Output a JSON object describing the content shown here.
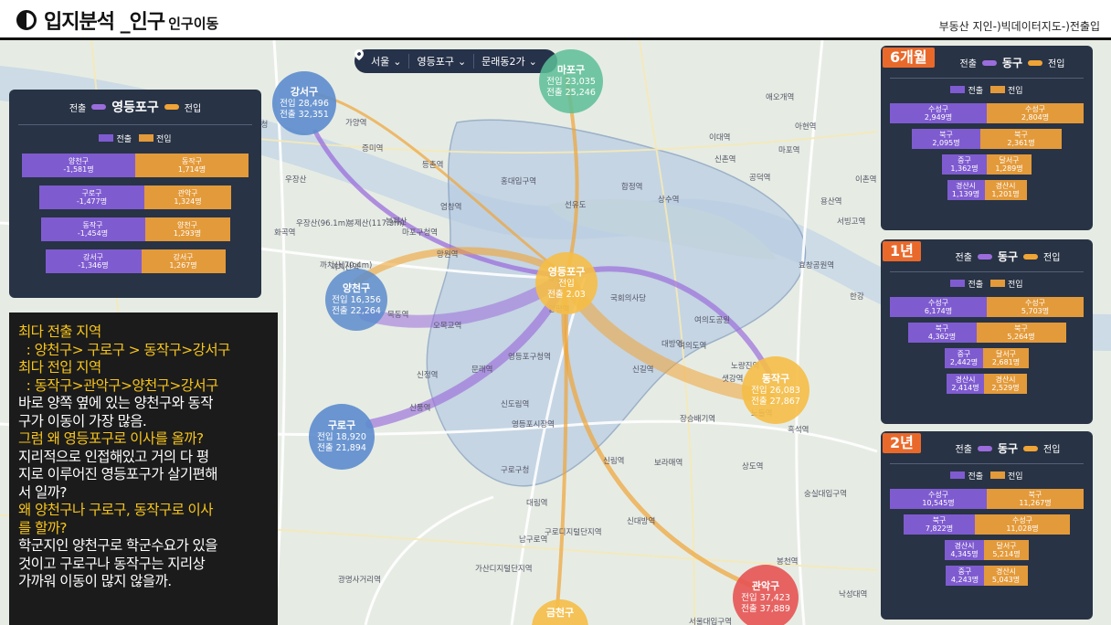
{
  "header": {
    "title_main": "입지분석 _인구",
    "title_sub": "인구이동",
    "breadcrumb": "부동산 지인-)빅데이터지도-)전출입"
  },
  "selector": {
    "city": "서울",
    "district": "영등포구",
    "dong": "문래동2가"
  },
  "colors": {
    "out_flow": "#9b6ddc",
    "in_flow": "#f0a436",
    "panel_bg": "#283345",
    "badge": "#e9692b"
  },
  "bubbles": [
    {
      "id": "gangseo",
      "name": "강서구",
      "out": "전입 28,496",
      "in": "전출 32,351"
    },
    {
      "id": "mapo",
      "name": "마포구",
      "out": "전입 23,035",
      "in": "전출 25,246"
    },
    {
      "id": "yangcheon",
      "name": "양천구",
      "out": "전입 16,356",
      "in": "전출 22,264"
    },
    {
      "id": "yeongdeungpo",
      "name": "영등포구",
      "out": "전입",
      "in": "전출 2.03"
    },
    {
      "id": "dongjak",
      "name": "동작구",
      "out": "전입 26,083",
      "in": "전출 27,867"
    },
    {
      "id": "guro",
      "name": "구로구",
      "out": "전입 18,920",
      "in": "전출 21,894"
    },
    {
      "id": "gwanak",
      "name": "관악구",
      "out": "전입 37,423",
      "in": "전출 37,889"
    },
    {
      "id": "geumcheon",
      "name": "금천구",
      "out": "",
      "in": ""
    }
  ],
  "main_panel": {
    "out_label": "전출",
    "in_label": "전입",
    "district": "영등포구",
    "legend_out": "전출",
    "legend_in": "전입",
    "rows": [
      {
        "out_name": "양천구",
        "out_val": "-1,581명",
        "in_name": "동작구",
        "in_val": "1,714명",
        "out_frac": 1.0,
        "in_frac": 1.0
      },
      {
        "out_name": "구로구",
        "out_val": "-1,477명",
        "in_name": "관악구",
        "in_val": "1,324명",
        "out_frac": 0.93,
        "in_frac": 0.77
      },
      {
        "out_name": "동작구",
        "out_val": "-1,454명",
        "in_name": "양천구",
        "in_val": "1,293명",
        "out_frac": 0.92,
        "in_frac": 0.75
      },
      {
        "out_name": "강서구",
        "out_val": "-1,346명",
        "in_name": "강서구",
        "in_val": "1,267명",
        "out_frac": 0.85,
        "in_frac": 0.74
      }
    ]
  },
  "side_panels": [
    {
      "badge": "6개월",
      "out_label": "전출",
      "district": "동구",
      "in_label": "전입",
      "legend_out": "전출",
      "legend_in": "전입",
      "rows": [
        {
          "out_name": "수성구",
          "out_val": "2,949명",
          "in_name": "수성구",
          "in_val": "2,804명",
          "out_frac": 1.0,
          "in_frac": 1.0
        },
        {
          "out_name": "북구",
          "out_val": "2,095명",
          "in_name": "북구",
          "in_val": "2,361명",
          "out_frac": 0.71,
          "in_frac": 0.84
        },
        {
          "out_name": "중구",
          "out_val": "1,362명",
          "in_name": "달서구",
          "in_val": "1,289명",
          "out_frac": 0.46,
          "in_frac": 0.46
        },
        {
          "out_name": "경산시",
          "out_val": "1,139명",
          "in_name": "경산시",
          "in_val": "1,201명",
          "out_frac": 0.39,
          "in_frac": 0.43
        }
      ]
    },
    {
      "badge": "1년",
      "out_label": "전출",
      "district": "동구",
      "in_label": "전입",
      "legend_out": "전출",
      "legend_in": "전입",
      "rows": [
        {
          "out_name": "수성구",
          "out_val": "6,174명",
          "in_name": "수성구",
          "in_val": "5,703명",
          "out_frac": 1.0,
          "in_frac": 1.0
        },
        {
          "out_name": "북구",
          "out_val": "4,362명",
          "in_name": "북구",
          "in_val": "5,264명",
          "out_frac": 0.71,
          "in_frac": 0.92
        },
        {
          "out_name": "중구",
          "out_val": "2,442명",
          "in_name": "달서구",
          "in_val": "2,681명",
          "out_frac": 0.4,
          "in_frac": 0.47
        },
        {
          "out_name": "경산시",
          "out_val": "2,414명",
          "in_name": "경산시",
          "in_val": "2,529명",
          "out_frac": 0.39,
          "in_frac": 0.44
        }
      ]
    },
    {
      "badge": "2년",
      "out_label": "전출",
      "district": "동구",
      "in_label": "전입",
      "legend_out": "전출",
      "legend_in": "전입",
      "rows": [
        {
          "out_name": "수성구",
          "out_val": "10,545명",
          "in_name": "북구",
          "in_val": "11,267명",
          "out_frac": 1.0,
          "in_frac": 1.0
        },
        {
          "out_name": "북구",
          "out_val": "7,822명",
          "in_name": "수성구",
          "in_val": "11,028명",
          "out_frac": 0.74,
          "in_frac": 0.98
        },
        {
          "out_name": "경산시",
          "out_val": "4,345명",
          "in_name": "달서구",
          "in_val": "5,214명",
          "out_frac": 0.41,
          "in_frac": 0.46
        },
        {
          "out_name": "중구",
          "out_val": "4,243명",
          "in_name": "경산시",
          "in_val": "5,043명",
          "out_frac": 0.4,
          "in_frac": 0.45
        }
      ]
    }
  ],
  "analysis": {
    "l1": "최다 전출 지역",
    "l2": "  : 양천구> 구로구 > 동작구>강서구",
    "l3": "최다 전입 지역",
    "l4": "  : 동작구>관악구>양천구>강서구",
    "l5": "바로 양쪽 옆에 있는 양천구와 동작",
    "l6": "구가 이동이 가장 많음.",
    "l7": "그럼 왜 영등포구로 이사를 올까?",
    "l8": "지리적으로 인접해있고 거의 다 평",
    "l9": "지로 이루어진 영등포구가 살기편해",
    "l10": "서 일까?",
    "l11": "왜 양천구나 구로구, 동작구로 이사",
    "l12": "를 할까?",
    "l13": "학군지인 양천구로 학군수요가 있을",
    "l14": "것이고 구로구나 동작구는 지리상",
    "l15": "가까워 이동이 많지 않을까."
  },
  "map_labels": [
    "김포공항",
    "강서구청",
    "가양역",
    "증미역",
    "등촌역",
    "염창역",
    "봉제산",
    "화곡역",
    "까치산역",
    "목동역",
    "오목교역",
    "신정역",
    "신도림역",
    "대림역",
    "구로구청",
    "남구로역",
    "가산디지털단지역",
    "구로디지털단지역",
    "신대방역",
    "신림역",
    "보라매역",
    "서울대입구역",
    "봉천역",
    "낙성대역",
    "노량진역",
    "흑석역",
    "신길역",
    "대방역",
    "여의도역",
    "국회의사당",
    "당산역",
    "선유도",
    "합정역",
    "상수역",
    "공덕역",
    "마포역",
    "효창공원역",
    "용산역",
    "이촌역",
    "서빙고역",
    "신촌역",
    "이대역",
    "아현역",
    "애오개역",
    "홍대입구역",
    "망원역",
    "마포구청역",
    "관악역",
    "독산역",
    "광명사거리역",
    "철산역",
    "개봉역",
    "오류동역",
    "숭실대입구역",
    "상도역",
    "장승배기역",
    "양평역",
    "영등포구청역",
    "문래역",
    "영등포시장역",
    "신풍역",
    "우장산",
    "봉제산(117.3m)",
    "까치산(70.4m)",
    "우장산(96.1m)",
    "여의도공원",
    "샛강역",
    "한강",
    "노들역"
  ]
}
